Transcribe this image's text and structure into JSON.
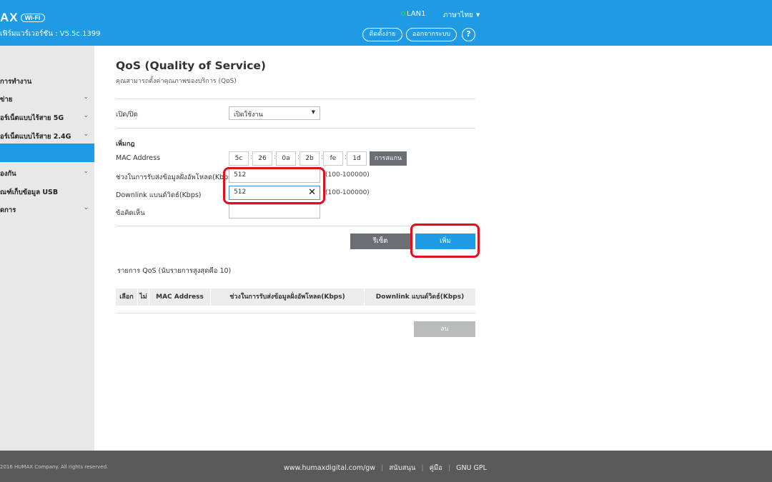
{
  "header": {
    "logo_text": "AX",
    "wifi_badge": "Wi-Fi",
    "firmware": "เฟิร์มแวร์เวอร์ชัน : V5.5c.1399",
    "lan_status": "LAN1",
    "language": "ภาษาไทย",
    "contact_button": "ติดตั้งง่าย",
    "logout_button": "ออกจากระบบ",
    "help_button": "?"
  },
  "sidebar": {
    "items": [
      {
        "label": "การทำงาน",
        "has_chevron": false
      },
      {
        "label": "ข่าย",
        "has_chevron": true
      },
      {
        "label": "อร์เน็ตแบบไร้สาย 5G",
        "has_chevron": true
      },
      {
        "label": "อร์เน็ตแบบไร้สาย 2.4G",
        "has_chevron": true
      },
      {
        "label": "",
        "active": true
      },
      {
        "label": "องกัน",
        "has_chevron": true
      },
      {
        "label": "ณฑ์เก็บข้อมูล USB",
        "has_chevron": false
      },
      {
        "label": "ดการ",
        "has_chevron": true
      }
    ]
  },
  "page": {
    "title": "QoS (Quality of Service)",
    "subtitle": "คุณสามารถตั้งค่าคุณภาพของบริการ (QoS)",
    "enable_label": "เปิด/ปิด",
    "enable_value": "เปิดใช้งาน",
    "add_rule_section": "เพิ่มกฎ",
    "mac_label": "MAC Address",
    "mac_octets": [
      "5c",
      "26",
      "0a",
      "2b",
      "fe",
      "1d"
    ],
    "scan_button": "การสแกน",
    "uplink_label": "ช่วงในการรับส่งข้อมูลฝั่งอัพโหลด(Kbps)",
    "uplink_value": "512",
    "uplink_range": "(100-100000)",
    "downlink_label": "Downlink แบนด์วิดธ์(Kbps)",
    "downlink_value": "512",
    "downlink_range": "(100-100000)",
    "comment_label": "ข้อคิดเห็น",
    "comment_value": "",
    "reset_button": "รีเซ็ต",
    "add_button": "เพิ่ม",
    "list_title": "รายการ QoS  (นับรายการสูงสุดคือ 10)",
    "table_headers": [
      "เลือก",
      "ไม่",
      "MAC Address",
      "ช่วงในการรับส่งข้อมูลฝั่งอัพโหลด(Kbps)",
      "Downlink แบนด์วิดธ์(Kbps)"
    ],
    "delete_button": "ลบ"
  },
  "footer": {
    "copyright": "2016 HUMAX Company. All rights reserved.",
    "links": [
      "www.humaxdigital.com/gw",
      "สนับสนุน",
      "คู่มือ",
      "GNU GPL"
    ]
  },
  "colors": {
    "brand_blue": "#1f9be6",
    "sidebar_bg": "#e8e8e8",
    "footer_bg": "#5a5a5a",
    "highlight_red": "#e3101b"
  }
}
